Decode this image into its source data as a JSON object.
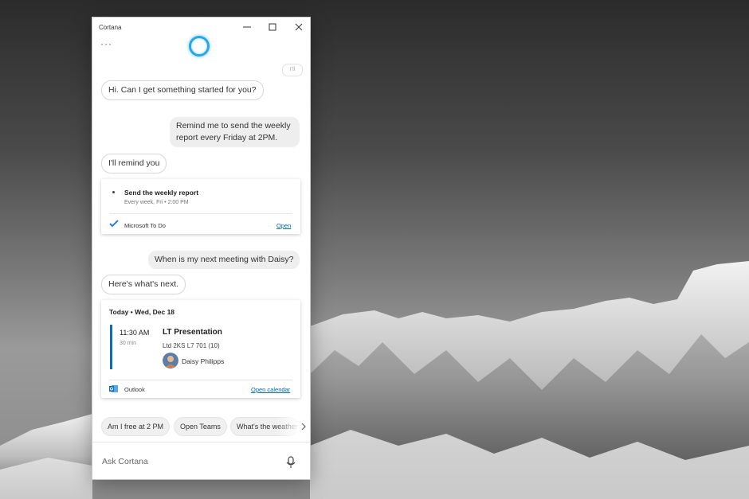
{
  "window": {
    "title": "Cortana",
    "controls": [
      "minimize-icon",
      "maximize-icon",
      "close-icon"
    ],
    "more_label": "···"
  },
  "chat": {
    "ghost_chip": "I'll",
    "greeting": "Hi. Can I get something started for you?",
    "user_message_1_line1": "Remind me to send the weekly",
    "user_message_1_line2": "report every Friday at 2PM.",
    "reply_1": "I'll remind you",
    "reminder_card": {
      "task": "Send the weekly report",
      "schedule": "Every week, Fri • 2:00 PM",
      "source": "Microsoft To Do",
      "action": "Open"
    },
    "user_message_2": "When is my next meeting with Daisy?",
    "reply_2": "Here's what's next.",
    "calendar_card": {
      "day": "Today • Wed, Dec 18",
      "time": "11:30 AM",
      "duration": "30 min",
      "title": "LT Presentation",
      "location": "Ltd 2KS L7 701 (10)",
      "attendee": "Daisy Philipps",
      "source": "Outlook",
      "action": "Open calendar"
    }
  },
  "suggestions": [
    "Am I free at 2 PM",
    "Open Teams",
    "What's the weather"
  ],
  "ask": {
    "placeholder": "Ask Cortana"
  },
  "colors": {
    "accent": "#0f6cbd",
    "cortana_ring": "#29a8e7",
    "link": "#0067c0"
  }
}
